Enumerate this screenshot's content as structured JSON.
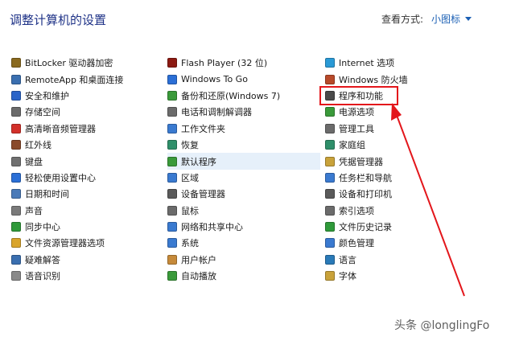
{
  "header": {
    "title": "调整计算机的设置",
    "view_by_label": "查看方式:",
    "view_by_value": "小图标"
  },
  "columns": [
    [
      {
        "label": "BitLocker 驱动器加密",
        "icon": "bitlocker-key-icon",
        "color": "#8a6a1f"
      },
      {
        "label": "RemoteApp 和桌面连接",
        "icon": "remote-desktop-icon",
        "color": "#3a6fb0"
      },
      {
        "label": "安全和维护",
        "icon": "flag-icon",
        "color": "#2a64c8"
      },
      {
        "label": "存储空间",
        "icon": "storage-icon",
        "color": "#6b6b6b"
      },
      {
        "label": "高清晰音频管理器",
        "icon": "audio-manager-icon",
        "color": "#d3302a"
      },
      {
        "label": "红外线",
        "icon": "infrared-icon",
        "color": "#8a4a2a"
      },
      {
        "label": "键盘",
        "icon": "keyboard-icon",
        "color": "#707070"
      },
      {
        "label": "轻松使用设置中心",
        "icon": "ease-of-access-icon",
        "color": "#2b6fd6"
      },
      {
        "label": "日期和时间",
        "icon": "clock-icon",
        "color": "#4a7ab8"
      },
      {
        "label": "声音",
        "icon": "speaker-icon",
        "color": "#7a7a7a"
      },
      {
        "label": "同步中心",
        "icon": "sync-icon",
        "color": "#2f9a3a"
      },
      {
        "label": "文件资源管理器选项",
        "icon": "folder-options-icon",
        "color": "#d9a52b"
      },
      {
        "label": "疑难解答",
        "icon": "troubleshoot-icon",
        "color": "#3a6fb0"
      },
      {
        "label": "语音识别",
        "icon": "microphone-icon",
        "color": "#8a8a8a"
      }
    ],
    [
      {
        "label": "Flash Player (32 位)",
        "icon": "flash-icon",
        "color": "#8c1a12"
      },
      {
        "label": "Windows To Go",
        "icon": "windows-to-go-icon",
        "color": "#2b6fd6"
      },
      {
        "label": "备份和还原(Windows 7)",
        "icon": "backup-icon",
        "color": "#3a9a3a"
      },
      {
        "label": "电话和调制解调器",
        "icon": "phone-modem-icon",
        "color": "#6b6b6b"
      },
      {
        "label": "工作文件夹",
        "icon": "work-folders-icon",
        "color": "#3a7ad0"
      },
      {
        "label": "恢复",
        "icon": "recovery-icon",
        "color": "#2f8f6a"
      },
      {
        "label": "默认程序",
        "icon": "default-programs-icon",
        "color": "#3a9a3a"
      },
      {
        "label": "区域",
        "icon": "region-icon",
        "color": "#3a7ad0"
      },
      {
        "label": "设备管理器",
        "icon": "device-manager-icon",
        "color": "#5a5a5a"
      },
      {
        "label": "鼠标",
        "icon": "mouse-icon",
        "color": "#6b6b6b"
      },
      {
        "label": "网络和共享中心",
        "icon": "network-icon",
        "color": "#3a7ad0"
      },
      {
        "label": "系统",
        "icon": "system-icon",
        "color": "#3a7ad0"
      },
      {
        "label": "用户帐户",
        "icon": "user-accounts-icon",
        "color": "#c68a3a"
      },
      {
        "label": "自动播放",
        "icon": "autoplay-icon",
        "color": "#3a9a3a"
      }
    ],
    [
      {
        "label": "Internet 选项",
        "icon": "internet-options-icon",
        "color": "#2a9ad6"
      },
      {
        "label": "Windows 防火墙",
        "icon": "firewall-icon",
        "color": "#b84a2a"
      },
      {
        "label": "程序和功能",
        "icon": "programs-features-icon",
        "color": "#4a4a4a"
      },
      {
        "label": "电源选项",
        "icon": "power-options-icon",
        "color": "#3a9a3a"
      },
      {
        "label": "管理工具",
        "icon": "admin-tools-icon",
        "color": "#6b6b6b"
      },
      {
        "label": "家庭组",
        "icon": "homegroup-icon",
        "color": "#2f8f6a"
      },
      {
        "label": "凭据管理器",
        "icon": "credential-manager-icon",
        "color": "#c9a23a"
      },
      {
        "label": "任务栏和导航",
        "icon": "taskbar-icon",
        "color": "#3a7ad0"
      },
      {
        "label": "设备和打印机",
        "icon": "printer-icon",
        "color": "#5a5a5a"
      },
      {
        "label": "索引选项",
        "icon": "indexing-icon",
        "color": "#6b6b6b"
      },
      {
        "label": "文件历史记录",
        "icon": "file-history-icon",
        "color": "#2f9a3a"
      },
      {
        "label": "颜色管理",
        "icon": "color-management-icon",
        "color": "#3a7ad0"
      },
      {
        "label": "语言",
        "icon": "language-icon",
        "color": "#2a7ab8"
      },
      {
        "label": "字体",
        "icon": "fonts-icon",
        "color": "#c9a23a"
      }
    ]
  ],
  "highlighted_item": "默认程序",
  "annotation_color": "#e3161b",
  "watermark": "头条 @longlingFo"
}
